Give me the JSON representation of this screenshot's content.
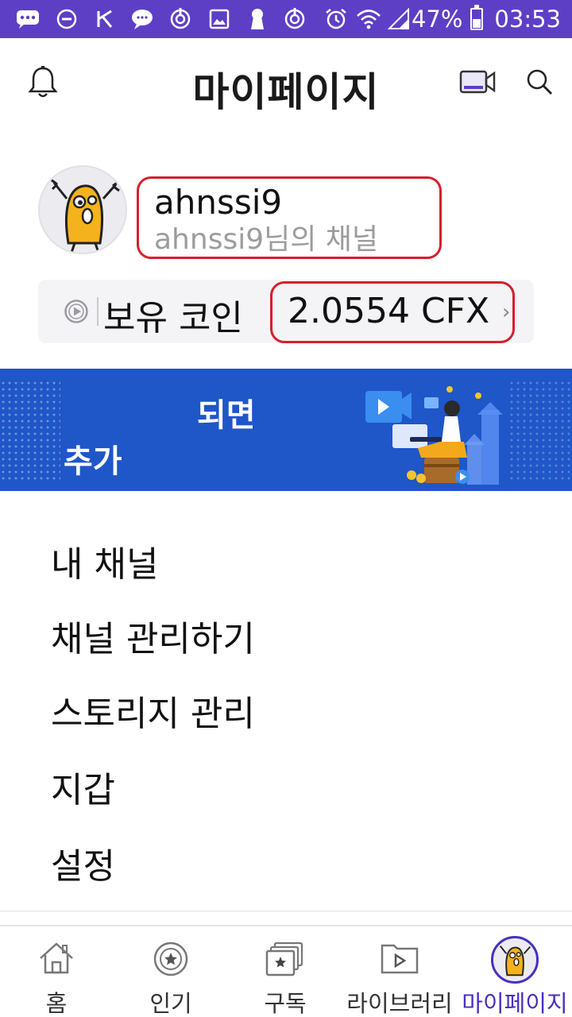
{
  "status_bar": {
    "battery": "47%",
    "time": "03:53",
    "battery_level": 0.47,
    "icons": [
      "messages-icon",
      "do-not-disturb-icon",
      "flash-off-icon",
      "chat-icon",
      "sync-icon",
      "image-icon",
      "keyhole-icon",
      "sync-icon",
      "alarm-icon",
      "wifi-icon",
      "signal-icon",
      "battery-icon"
    ]
  },
  "header": {
    "title": "마이페이지",
    "icons": [
      "bell-icon",
      "video-camera-icon",
      "search-icon"
    ]
  },
  "profile": {
    "username": "ahnssi9",
    "channel_name": "ahnssi9님의 채널"
  },
  "coins": {
    "label": "보유 코인",
    "value": "2.0554 CFX",
    "chevron": "›"
  },
  "banner": {
    "line1": "되면",
    "line2": "추가"
  },
  "menu": {
    "items": [
      {
        "label": "내 채널"
      },
      {
        "label": "채널 관리하기"
      },
      {
        "label": "스토리지 관리"
      },
      {
        "label": "지갑"
      },
      {
        "label": "설정"
      }
    ]
  },
  "bottom_nav": {
    "items": [
      {
        "label": "홈",
        "icon": "home-icon"
      },
      {
        "label": "인기",
        "icon": "star-circle-icon"
      },
      {
        "label": "구독",
        "icon": "subscriptions-icon"
      },
      {
        "label": "라이브러리",
        "icon": "library-icon"
      },
      {
        "label": "마이페이지",
        "icon": "avatar-icon",
        "active": true
      }
    ]
  },
  "colors": {
    "status_bar": "#5d3fc6",
    "accent": "#4a2fbf",
    "banner": "#1f56c8",
    "highlight_box": "#d61f2c"
  }
}
